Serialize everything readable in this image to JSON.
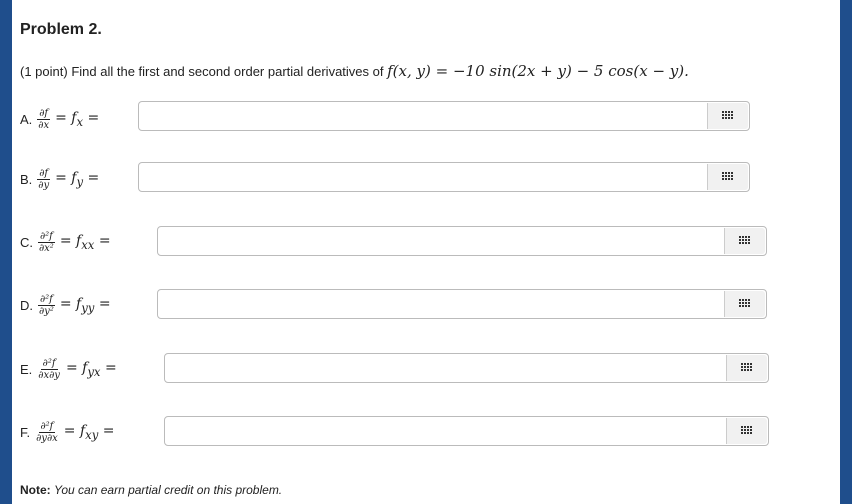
{
  "problem": {
    "title": "Problem 2.",
    "points": "(1 point)",
    "prompt": "Find all the first and second order partial derivatives of",
    "function": "f(x, y) = −10 sin(2x + y) − 5 cos(x − y)."
  },
  "parts": [
    {
      "letter": "A.",
      "num": "∂f",
      "den": "∂x",
      "expr": "= f",
      "sub": "x",
      "tail": "=",
      "value": "",
      "placeholder": ""
    },
    {
      "letter": "B.",
      "num": "∂f",
      "den": "∂y",
      "expr": "= f",
      "sub": "y",
      "tail": "=",
      "value": "",
      "placeholder": ""
    },
    {
      "letter": "C.",
      "num": "∂²f",
      "den": "∂x²",
      "expr": "= f",
      "sub": "xx",
      "tail": "=",
      "value": "",
      "placeholder": ""
    },
    {
      "letter": "D.",
      "num": "∂²f",
      "den": "∂y²",
      "expr": "= f",
      "sub": "yy",
      "tail": "=",
      "value": "",
      "placeholder": ""
    },
    {
      "letter": "E.",
      "num": "∂²f",
      "den": "∂x∂y",
      "expr": "= f",
      "sub": "yx",
      "tail": "=",
      "value": "",
      "placeholder": ""
    },
    {
      "letter": "F.",
      "num": "∂²f",
      "den": "∂y∂x",
      "expr": "= f",
      "sub": "xy",
      "tail": "=",
      "value": "",
      "placeholder": ""
    }
  ],
  "note": {
    "label": "Note:",
    "text": "You can earn partial credit on this problem."
  },
  "icons": {
    "matrix": "matrix-grid-icon"
  },
  "colors": {
    "frame": "#1f4e8c"
  }
}
